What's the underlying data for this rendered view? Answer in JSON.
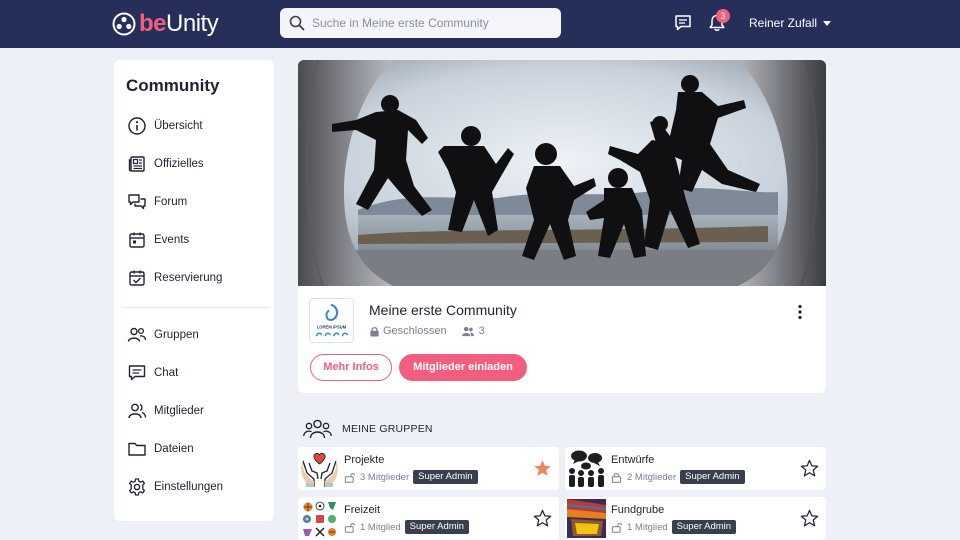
{
  "brand": {
    "prefix": "be",
    "name": "Unity",
    "accent": "#f25e7e",
    "navy": "#262f5a"
  },
  "topbar": {
    "search_placeholder": "Suche in Meine erste Community",
    "notification_count": "3",
    "user_name": "Reiner Zufall",
    "icons": [
      "search-icon",
      "chat-icon",
      "bell-icon",
      "caret-down-icon"
    ]
  },
  "sidebar": {
    "title": "Community",
    "items": [
      {
        "label": "Übersicht",
        "icon": "info-icon"
      },
      {
        "label": "Offizielles",
        "icon": "newspaper-icon"
      },
      {
        "label": "Forum",
        "icon": "forum-icon"
      },
      {
        "label": "Events",
        "icon": "calendar-icon"
      },
      {
        "label": "Reservierung",
        "icon": "calendar-check-icon"
      },
      {
        "label": "Gruppen",
        "icon": "groups-icon"
      },
      {
        "label": "Chat",
        "icon": "chat-icon"
      },
      {
        "label": "Mitglieder",
        "icon": "members-icon"
      },
      {
        "label": "Dateien",
        "icon": "folder-icon"
      },
      {
        "label": "Einstellungen",
        "icon": "gear-icon"
      }
    ]
  },
  "community": {
    "name": "Meine erste Community",
    "status": "Geschlossen",
    "member_count": "3",
    "logo_text": "LOREM IPSUM",
    "more_info_label": "Mehr Infos",
    "invite_label": "Mitglieder einladen"
  },
  "groups": {
    "heading": "MEINE GRUPPEN",
    "items": [
      {
        "name": "Projekte",
        "members": "3 Mitglieder",
        "role": "Super Admin",
        "favorite": true
      },
      {
        "name": "Entwürfe",
        "members": "2 Mitglieder",
        "role": "Super Admin",
        "favorite": false
      },
      {
        "name": "Freizeit",
        "members": "1 Mitglied",
        "role": "Super Admin",
        "favorite": false
      },
      {
        "name": "Fundgrube",
        "members": "1 Mitglied",
        "role": "Super Admin",
        "favorite": false
      }
    ]
  }
}
